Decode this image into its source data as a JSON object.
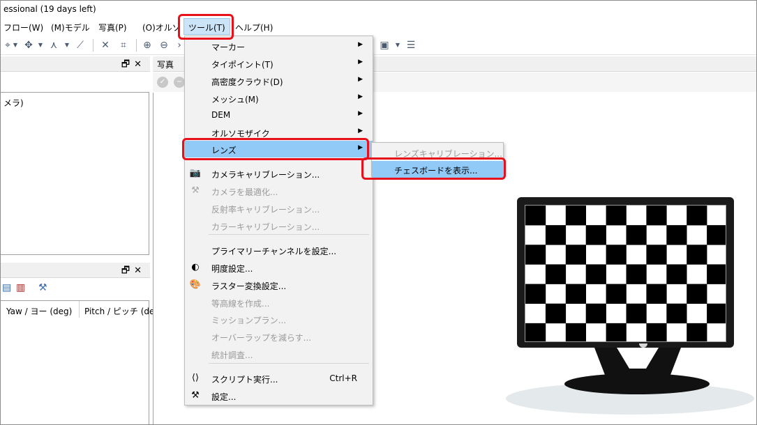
{
  "window": {
    "title": "essional (19 days left)"
  },
  "menubar": {
    "items": [
      {
        "label": "フロー(W)"
      },
      {
        "label": "(M)モデル"
      },
      {
        "label": "写真(P)"
      },
      {
        "label": "(O)オルソ"
      },
      {
        "label": "ツール(T)"
      },
      {
        "label": "ヘルプ(H)"
      }
    ]
  },
  "left_panel_top": {
    "tree_item": "メラ)"
  },
  "left_panel_bottom": {
    "columns": [
      "Yaw / ヨー (deg)",
      "Pitch / ピッチ (de"
    ]
  },
  "photos_panel": {
    "title": "写真"
  },
  "tools_menu": {
    "items": [
      {
        "label": "マーカー",
        "submenu": true,
        "disabled": false,
        "icon": ""
      },
      {
        "label": "タイポイント(T)",
        "submenu": true,
        "disabled": false,
        "icon": ""
      },
      {
        "label": "高密度クラウド(D)",
        "submenu": true,
        "disabled": false,
        "icon": ""
      },
      {
        "label": "メッシュ(M)",
        "submenu": true,
        "disabled": false,
        "icon": ""
      },
      {
        "label": "DEM",
        "submenu": true,
        "disabled": false,
        "icon": ""
      },
      {
        "label": "オルソモザイク",
        "submenu": true,
        "disabled": false,
        "icon": ""
      },
      {
        "label": "レンズ",
        "submenu": true,
        "disabled": false,
        "icon": "",
        "highlight": true
      },
      {
        "label": "カメラキャリブレーション...",
        "disabled": false,
        "icon": "camera-icon"
      },
      {
        "label": "カメラを最適化...",
        "disabled": true,
        "icon": "wand-icon"
      },
      {
        "label": "反射率キャリブレーション...",
        "disabled": true,
        "icon": ""
      },
      {
        "label": "カラーキャリブレーション...",
        "disabled": true,
        "icon": ""
      },
      {
        "label": "プライマリーチャンネルを設定...",
        "disabled": false,
        "icon": ""
      },
      {
        "label": "明度設定...",
        "disabled": false,
        "icon": "brightness-icon"
      },
      {
        "label": "ラスター変換設定...",
        "disabled": false,
        "icon": "palette-icon"
      },
      {
        "label": "等高線を作成...",
        "disabled": true,
        "icon": ""
      },
      {
        "label": "ミッションプラン...",
        "disabled": true,
        "icon": ""
      },
      {
        "label": "オーバーラップを減らす...",
        "disabled": true,
        "icon": ""
      },
      {
        "label": "統計調査...",
        "disabled": true,
        "icon": ""
      },
      {
        "label": "スクリプト実行...",
        "disabled": false,
        "icon": "script-icon",
        "shortcut": "Ctrl+R"
      },
      {
        "label": "設定...",
        "disabled": false,
        "icon": "settings-icon"
      }
    ]
  },
  "lens_submenu": {
    "items": [
      {
        "label": "レンズキャリブレーション...",
        "disabled": true
      },
      {
        "label": "チェスボードを表示...",
        "disabled": false,
        "highlight": true
      }
    ]
  },
  "icons": {
    "panel_restore": "restore-icon",
    "panel_close": "close-icon",
    "callout_color": "#e8101b"
  },
  "colors": {
    "highlight": "#91c9f7",
    "menu_bg": "#f2f2f2",
    "disabled_text": "#9a9a9a",
    "monitor": "#1a1a1a"
  }
}
